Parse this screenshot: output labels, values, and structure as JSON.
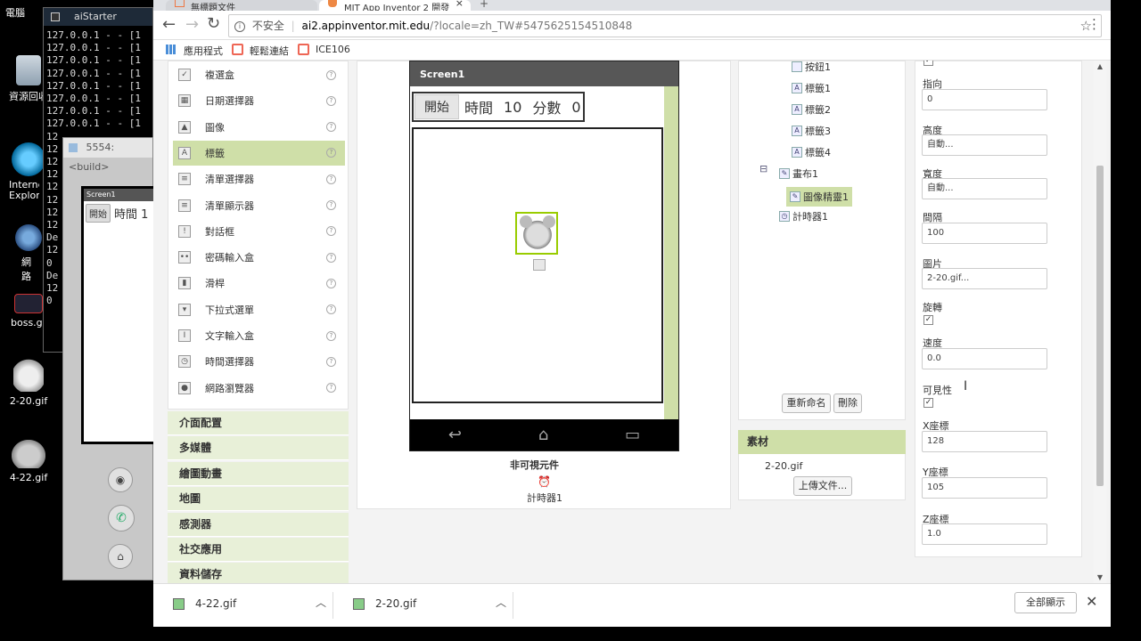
{
  "desktop": {
    "icons": [
      {
        "label": "電腦"
      },
      {
        "label": "資源回收"
      },
      {
        "label": "Internet Explorer"
      },
      {
        "label": "網路"
      },
      {
        "label": "boss.g"
      },
      {
        "label": "2-20.gif"
      },
      {
        "label": "4-22.gif"
      }
    ]
  },
  "terminal": {
    "title": "aiStarter",
    "lines": [
      "127.0.0.1 - - [1",
      "127.0.0.1 - - [1",
      "127.0.0.1 - - [1",
      "127.0.0.1 - - [1",
      "127.0.0.1 - - [1",
      "127.0.0.1 - - [1",
      "127.0.0.1 - - [1",
      "127.0.0.1 - - [1",
      "12",
      "12",
      "12",
      "12",
      "12",
      "12",
      "12",
      "12",
      "De",
      "12",
      "0",
      "De",
      "12",
      "0"
    ]
  },
  "emulator": {
    "title": "5554:<build>",
    "screen_title": "Screen1",
    "start_btn": "開始",
    "time_label": "時間 1"
  },
  "browser": {
    "tabs": [
      {
        "label": "無標題文件"
      },
      {
        "label": "MIT App Inventor 2 開發"
      }
    ],
    "security": "不安全",
    "url_host": "ai2.appinventor.mit.edu",
    "url_rest": "/?locale=zh_TW#5475625154510848",
    "bookmarks": [
      {
        "label": "應用程式"
      },
      {
        "label": "輕鬆連結"
      },
      {
        "label": "ICE106"
      }
    ]
  },
  "palette": {
    "items": [
      {
        "label": "複選盒",
        "icon": "checkbox-icon",
        "glyph": "✓"
      },
      {
        "label": "日期選擇器",
        "icon": "calendar-icon",
        "glyph": "▦"
      },
      {
        "label": "圖像",
        "icon": "image-icon",
        "glyph": "▲"
      },
      {
        "label": "標籤",
        "icon": "label-icon",
        "glyph": "A"
      },
      {
        "label": "清單選擇器",
        "icon": "list-picker-icon",
        "glyph": "≡"
      },
      {
        "label": "清單顯示器",
        "icon": "list-view-icon",
        "glyph": "≡"
      },
      {
        "label": "對話框",
        "icon": "warning-icon",
        "glyph": "!"
      },
      {
        "label": "密碼輸入盒",
        "icon": "password-icon",
        "glyph": "••"
      },
      {
        "label": "滑桿",
        "icon": "slider-icon",
        "glyph": "▮"
      },
      {
        "label": "下拉式選單",
        "icon": "spinner-icon",
        "glyph": "▾"
      },
      {
        "label": "文字輸入盒",
        "icon": "textbox-icon",
        "glyph": "I"
      },
      {
        "label": "時間選擇器",
        "icon": "clock-icon",
        "glyph": "◷"
      },
      {
        "label": "網路瀏覽器",
        "icon": "globe-icon",
        "glyph": "●"
      }
    ],
    "help_glyph": "?",
    "categories": [
      {
        "label": "介面配置"
      },
      {
        "label": "多媒體"
      },
      {
        "label": "繪圖動畫"
      },
      {
        "label": "地圖"
      },
      {
        "label": "感測器"
      },
      {
        "label": "社交應用"
      },
      {
        "label": "資料儲存"
      }
    ]
  },
  "viewer": {
    "screen_title": "Screen1",
    "start_btn": "開始",
    "time_label": "時間",
    "time_value": "10",
    "score_label": "分數",
    "score_value": "0",
    "nonvisible_title": "非可視元件",
    "timer_label": "計時器1"
  },
  "components": {
    "items": [
      {
        "label": "按鈕1"
      },
      {
        "label": "標籤1"
      },
      {
        "label": "標籤2"
      },
      {
        "label": "標籤3"
      },
      {
        "label": "標籤4"
      },
      {
        "label": "畫布1"
      },
      {
        "label": "圖像精靈1"
      },
      {
        "label": "計時器1"
      }
    ],
    "rename_btn": "重新命名",
    "delete_btn": "刪除",
    "media_title": "素材",
    "media_file": "2-20.gif",
    "upload_btn": "上傳文件..."
  },
  "properties": {
    "heading_label": "指向",
    "heading_value": "0",
    "height_label": "高度",
    "height_value": "自動...",
    "width_label": "寬度",
    "width_value": "自動...",
    "interval_label": "間隔",
    "interval_value": "100",
    "picture_label": "圖片",
    "picture_value": "2-20.gif...",
    "rotates_label": "旋轉",
    "speed_label": "速度",
    "speed_value": "0.0",
    "visible_label": "可見性",
    "x_label": "X座標",
    "x_value": "128",
    "y_label": "Y座標",
    "y_value": "105",
    "z_label": "Z座標",
    "z_value": "1.0",
    "check_glyph": "✓"
  },
  "downloads": {
    "files": [
      {
        "label": "4-22.gif"
      },
      {
        "label": "2-20.gif"
      }
    ],
    "show_all": "全部顯示"
  },
  "colors": {
    "accent_green": "#cfdfa8",
    "category_bg": "#e8f0d8"
  }
}
